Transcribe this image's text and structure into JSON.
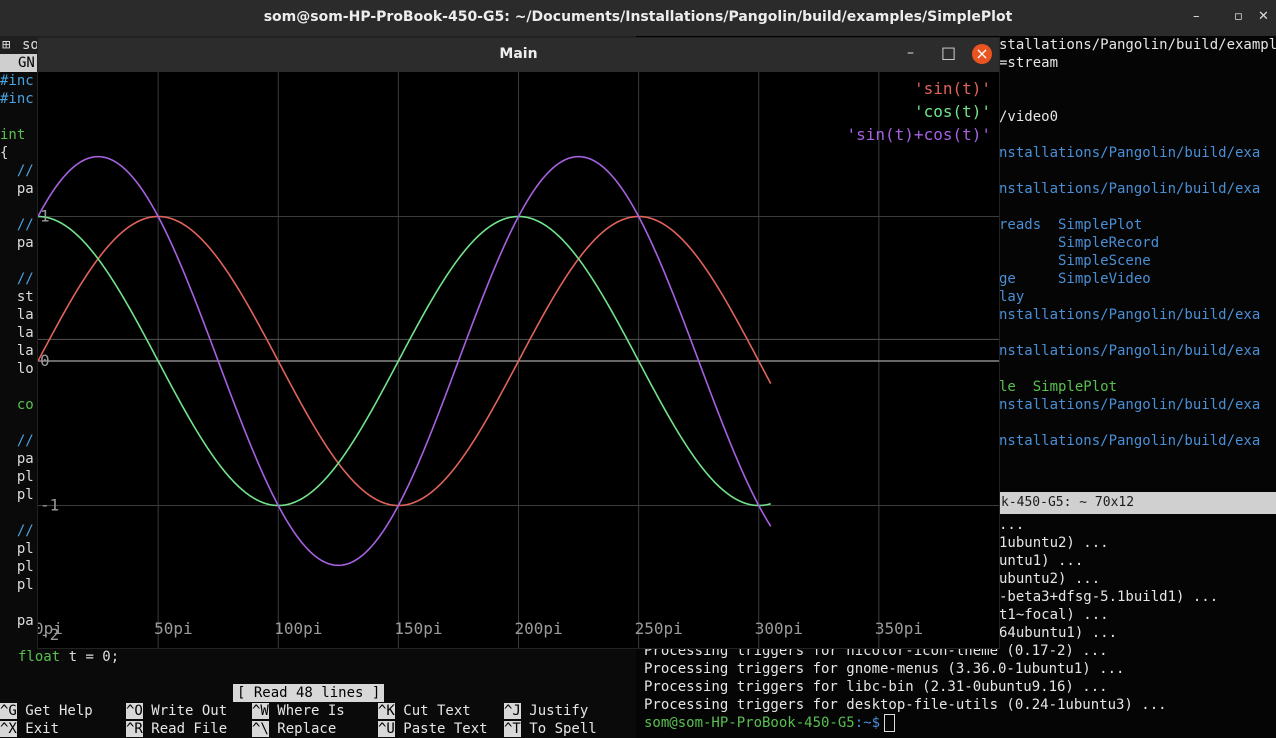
{
  "topbar": {
    "title": "som@som-HP-ProBook-450-G5: ~/Documents/Installations/Pangolin/build/examples/SimplePlot",
    "minimize": "–",
    "maximize": "▫",
    "close": "✕"
  },
  "nano": {
    "tab_label": "so",
    "header": "GN",
    "lines": [
      {
        "text": "#inc",
        "color": "#4aa3df"
      },
      {
        "text": "#inc",
        "color": "#4aa3df"
      },
      {
        "text": "",
        "color": "#ddd"
      },
      {
        "text": "int",
        "color": "#58c04f"
      },
      {
        "text": "{",
        "color": "#ddd"
      },
      {
        "text": "  //",
        "color": "#4aa3df"
      },
      {
        "text": "  pa",
        "color": "#ddd"
      },
      {
        "text": "",
        "color": "#ddd"
      },
      {
        "text": "  //",
        "color": "#4aa3df"
      },
      {
        "text": "  pa",
        "color": "#ddd"
      },
      {
        "text": "",
        "color": "#ddd"
      },
      {
        "text": "  //",
        "color": "#4aa3df"
      },
      {
        "text": "  st",
        "color": "#ddd"
      },
      {
        "text": "  la",
        "color": "#ddd"
      },
      {
        "text": "  la",
        "color": "#ddd"
      },
      {
        "text": "  la",
        "color": "#ddd"
      },
      {
        "text": "  lo",
        "color": "#ddd"
      },
      {
        "text": "",
        "color": "#ddd"
      },
      {
        "text": "  co",
        "color": "#58c04f"
      },
      {
        "text": "",
        "color": "#ddd"
      },
      {
        "text": "  //",
        "color": "#4aa3df"
      },
      {
        "text": "  pa",
        "color": "#ddd"
      },
      {
        "text": "  pl",
        "color": "#ddd"
      },
      {
        "text": "  pl",
        "color": "#ddd"
      },
      {
        "text": "",
        "color": "#ddd"
      },
      {
        "text": "  //",
        "color": "#4aa3df"
      },
      {
        "text": "  pl",
        "color": "#ddd"
      },
      {
        "text": "  pl",
        "color": "#ddd"
      },
      {
        "text": "  pl",
        "color": "#ddd"
      },
      {
        "text": "",
        "color": "#ddd"
      },
      {
        "text": "  pa",
        "color": "#ddd"
      }
    ],
    "float_line_kw": "float",
    "float_line_rest": " t = 0;",
    "status": "[ Read 48 lines ]",
    "shortcuts": [
      {
        "key": "^G",
        "label": "Get Help"
      },
      {
        "key": "^O",
        "label": "Write Out"
      },
      {
        "key": "^W",
        "label": "Where Is"
      },
      {
        "key": "^K",
        "label": "Cut Text"
      },
      {
        "key": "^J",
        "label": "Justify"
      },
      {
        "key": "^X",
        "label": "Exit"
      },
      {
        "key": "^R",
        "label": "Read File"
      },
      {
        "key": "^\\",
        "label": "Replace"
      },
      {
        "key": "^U",
        "label": "Paste Text"
      },
      {
        "key": "^T",
        "label": "To Spell"
      }
    ]
  },
  "right_terminal": {
    "lines": [
      {
        "text": "stallations/Pangolin/build/examples/Simp",
        "color": "#e6e6e6"
      },
      {
        "text": "=stream",
        "color": "#e6e6e6"
      },
      {
        "text": "",
        "color": "#e6e6e6"
      },
      {
        "text": "",
        "color": "#e6e6e6"
      },
      {
        "text": "/video0",
        "color": "#e6e6e6"
      },
      {
        "text": "",
        "color": "#e6e6e6"
      },
      {
        "text": "nstallations/Pangolin/build/exa",
        "color": "#4a8fd6"
      },
      {
        "text": "",
        "color": "#e6e6e6"
      },
      {
        "text": "nstallations/Pangolin/build/exa",
        "color": "#4a8fd6"
      },
      {
        "text": "",
        "color": "#e6e6e6"
      },
      {
        "text": "reads  SimplePlot",
        "color": "#4a8fd6"
      },
      {
        "text": "       SimpleRecord",
        "color": "#4a8fd6"
      },
      {
        "text": "       SimpleScene",
        "color": "#4a8fd6"
      },
      {
        "text": "ge     SimpleVideo",
        "color": "#4a8fd6"
      },
      {
        "text": "lay",
        "color": "#4a8fd6"
      },
      {
        "text": "nstallations/Pangolin/build/exa",
        "color": "#4a8fd6"
      },
      {
        "text": "",
        "color": "#e6e6e6"
      },
      {
        "text": "nstallations/Pangolin/build/exa",
        "color": "#4a8fd6"
      },
      {
        "text": "",
        "color": "#e6e6e6"
      },
      {
        "text": "le  SimplePlot",
        "color": "#58c04f"
      },
      {
        "text": "nstallations/Pangolin/build/exa",
        "color": "#4a8fd6"
      },
      {
        "text": "",
        "color": "#e6e6e6"
      },
      {
        "text": "nstallations/Pangolin/build/exa",
        "color": "#4a8fd6"
      }
    ],
    "tab_label": "k-450-G5: ~ 70x12"
  },
  "bottom_terminal": {
    "lines": [
      {
        "text": "...",
        "left": false
      },
      {
        "text": "1ubuntu2) ...",
        "left": false
      },
      {
        "text": "untu1) ...",
        "left": false
      },
      {
        "text": "ubuntu2) ...",
        "left": false
      },
      {
        "text": "-beta3+dfsg-5.1build1) ...",
        "left": false
      },
      {
        "text": "t1~focal) ...",
        "left": false
      },
      {
        "text": "64ubuntu1) ...",
        "left": false
      },
      {
        "text": "Processing triggers for hicolor-icon-theme (0.17-2) ...",
        "left": true
      },
      {
        "text": "Processing triggers for gnome-menus (3.36.0-1ubuntu1) ...",
        "left": true
      },
      {
        "text": "Processing triggers for libc-bin (2.31-0ubuntu9.16) ...",
        "left": true
      },
      {
        "text": "Processing triggers for desktop-file-utils (0.24-1ubuntu3) ...",
        "left": true
      }
    ],
    "prompt_user": "som@som-HP-ProBook-450-G5",
    "prompt_path": ":~$"
  },
  "plot_window": {
    "title": "Main",
    "minimize": "–",
    "maximize": "□",
    "close": "×"
  },
  "chart_data": {
    "type": "line",
    "x_unit": "pi",
    "x_ticks": [
      0,
      50,
      100,
      150,
      200,
      250,
      300,
      350
    ],
    "x_tick_labels": [
      "0pi",
      "50pi",
      "100pi",
      "150pi",
      "200pi",
      "250pi",
      "300pi",
      "350pi"
    ],
    "y_ticks": [
      -1,
      0,
      1
    ],
    "y_tick_labels": [
      "-1",
      "0",
      "1"
    ],
    "y_extra_label": "-2",
    "xlim": [
      0,
      400
    ],
    "ylim": [
      -1.75,
      1.7
    ],
    "grid": true,
    "legend_position": "top-right",
    "x_end": 305,
    "series": [
      {
        "name": "'sin(t)'",
        "color": "#e0635a",
        "function": "sin",
        "period": 200
      },
      {
        "name": "'cos(t)'",
        "color": "#72e38a",
        "function": "cos",
        "period": 200
      },
      {
        "name": "'sin(t)+cos(t)'",
        "color": "#a561e0",
        "function": "sin+cos",
        "period": 200
      }
    ]
  }
}
